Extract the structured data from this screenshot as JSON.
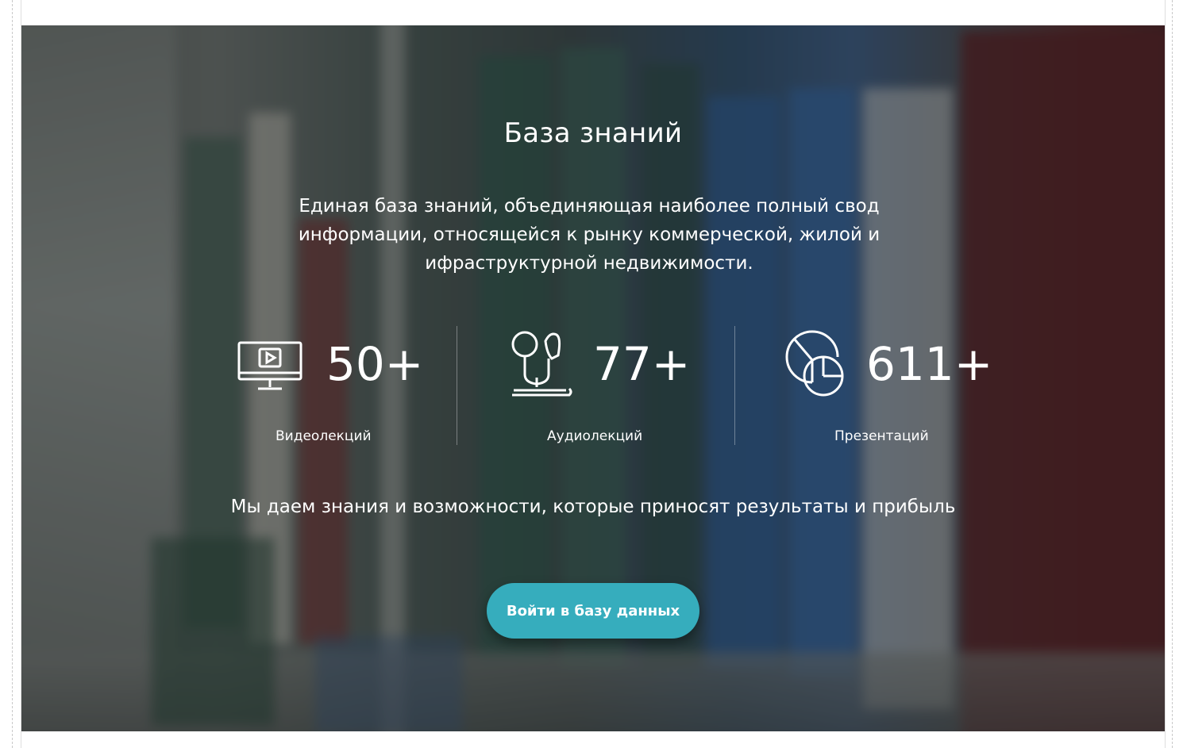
{
  "hero": {
    "title": "База знаний",
    "description": "Единая база знаний, объединяющая наиболее полный свод информации, относящейся к рынку коммерческой, жилой и ифраструктурной недвижимости.",
    "stats": [
      {
        "icon": "monitor-play-icon",
        "value": "50+",
        "label": "Видеолекций"
      },
      {
        "icon": "earphones-icon",
        "value": "77+",
        "label": "Аудиолекций"
      },
      {
        "icon": "pie-chart-icon",
        "value": "611+",
        "label": "Презентаций"
      }
    ],
    "slogan": "Мы даем знания и возможности, которые приносят результаты и прибыль",
    "cta_label": "Войти в базу данных"
  },
  "colors": {
    "accent": "#36adbd",
    "text": "#ffffff",
    "overlay": "#14181a"
  }
}
